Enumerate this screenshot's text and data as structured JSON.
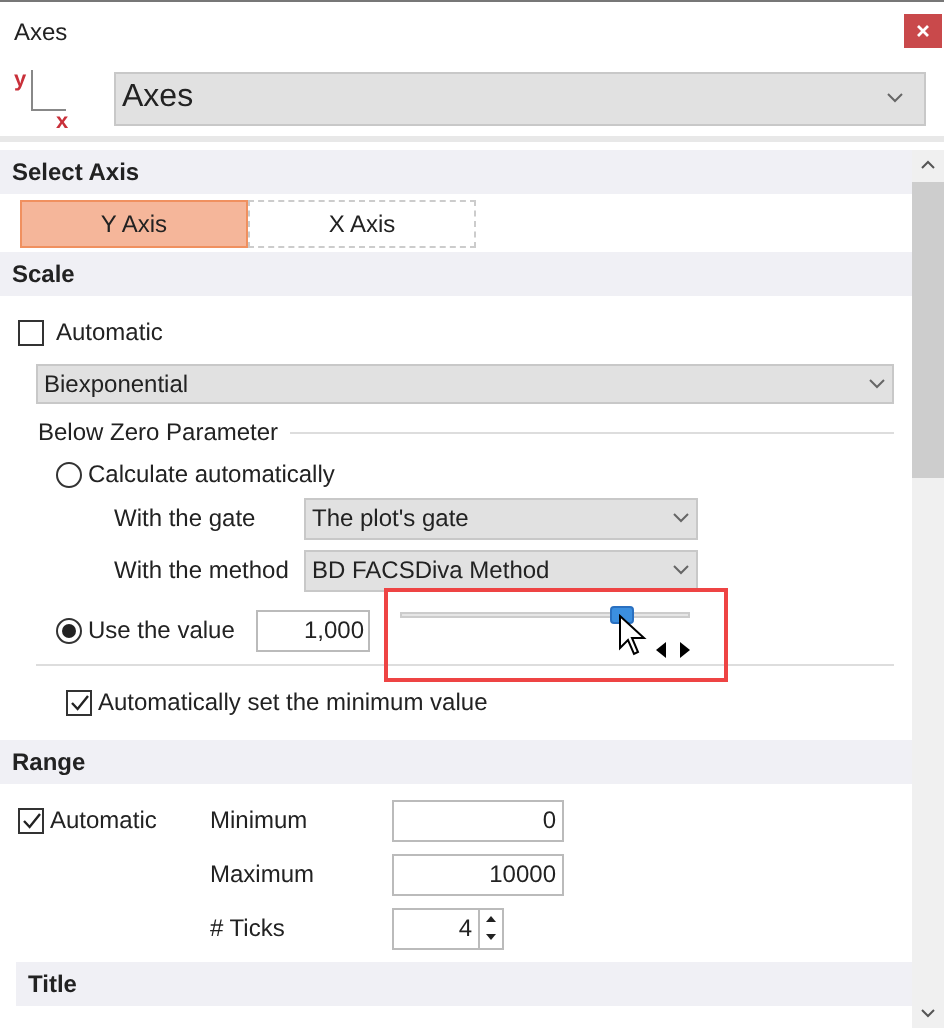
{
  "window": {
    "title": "Axes"
  },
  "header": {
    "axis_icon": {
      "y_label": "y",
      "x_label": "x"
    },
    "dropdown": {
      "value": "Axes"
    }
  },
  "select_axis": {
    "title": "Select Axis",
    "tabs": [
      {
        "label": "Y Axis",
        "selected": true
      },
      {
        "label": "X Axis",
        "selected": false
      }
    ]
  },
  "scale": {
    "title": "Scale",
    "automatic": {
      "label": "Automatic",
      "checked": false
    },
    "type_dropdown": {
      "value": "Biexponential"
    },
    "below_zero": {
      "title": "Below Zero Parameter",
      "calculate": {
        "label": "Calculate automatically",
        "selected": false
      },
      "gate": {
        "label": "With the gate",
        "value": "The plot's gate"
      },
      "method": {
        "label": "With the method",
        "value": "BD FACSDiva Method"
      },
      "use_value": {
        "label": "Use the value",
        "selected": true,
        "value": "1,000"
      },
      "slider": {
        "level": 0.77,
        "highlighted": true
      }
    },
    "auto_min": {
      "label": "Automatically set the minimum value",
      "checked": true
    }
  },
  "range": {
    "title": "Range",
    "automatic": {
      "label": "Automatic",
      "checked": true
    },
    "fields": [
      {
        "label": "Minimum",
        "value": "0",
        "kind": "text"
      },
      {
        "label": "Maximum",
        "value": "10000",
        "kind": "text"
      },
      {
        "label": "# Ticks",
        "value": "4",
        "kind": "spinner"
      }
    ]
  },
  "title_section": {
    "title": "Title"
  }
}
